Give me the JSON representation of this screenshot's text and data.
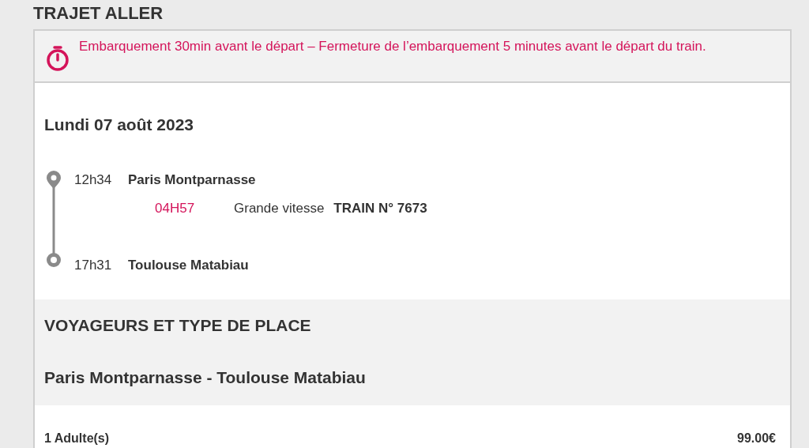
{
  "section_title": "TRAJET ALLER",
  "notice": "Embarquement 30min avant le départ – Fermeture de l’embarquement 5 minutes avant le départ du train.",
  "date": "Lundi 07 août 2023",
  "departure": {
    "time": "12h34",
    "station": "Paris Montparnasse"
  },
  "segment": {
    "duration": "04H57",
    "category": "Grande vitesse",
    "train": "TRAIN N° 7673"
  },
  "arrival": {
    "time": "17h31",
    "station": "Toulouse Matabiau"
  },
  "travellers": {
    "title": "VOYAGEURS ET TYPE DE PLACE",
    "route": "Paris Montparnasse - Toulouse Matabiau"
  },
  "fares": [
    {
      "label": "1 Adulte(s)",
      "price": "99.00€"
    }
  ]
}
